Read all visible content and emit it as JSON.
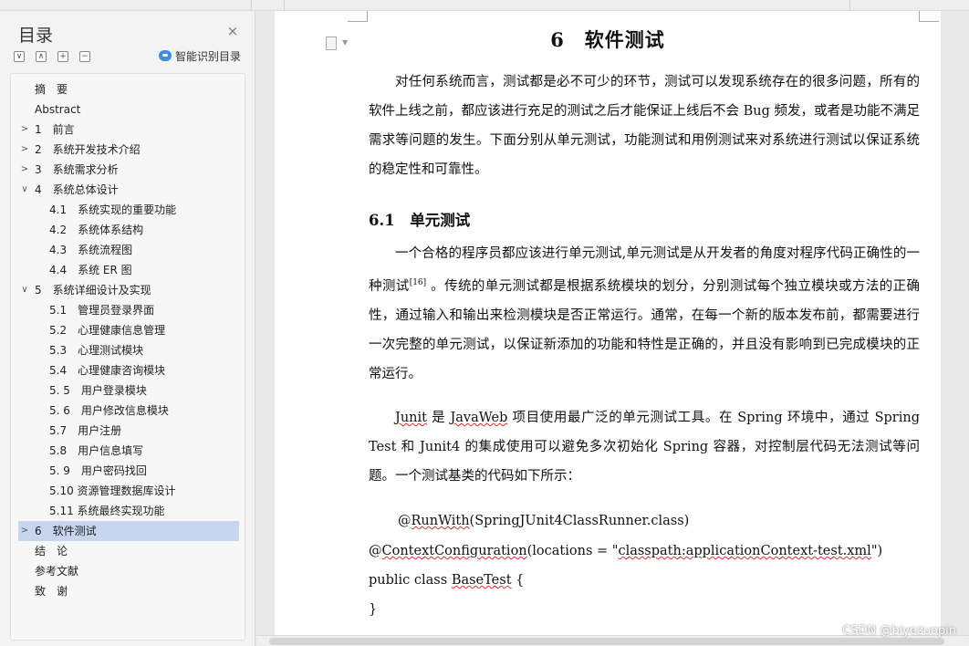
{
  "nav": {
    "title": "目录",
    "close": "×",
    "tools": [
      "∨",
      "∧",
      "+",
      "−"
    ],
    "smart_label": "智能识别目录",
    "items": [
      {
        "label": "摘　要",
        "level": 0,
        "arrow": ""
      },
      {
        "label": "Abstract",
        "level": 0,
        "arrow": ""
      },
      {
        "label": "1　前言",
        "level": 0,
        "arrow": ">"
      },
      {
        "label": "2　系统开发技术介绍",
        "level": 0,
        "arrow": ">"
      },
      {
        "label": "3　系统需求分析",
        "level": 0,
        "arrow": ">"
      },
      {
        "label": "4　系统总体设计",
        "level": 0,
        "arrow": "∨"
      },
      {
        "label": "4.1　系统实现的重要功能",
        "level": 1,
        "arrow": ""
      },
      {
        "label": "4.2　系统体系结构",
        "level": 1,
        "arrow": ""
      },
      {
        "label": "4.3　系统流程图",
        "level": 1,
        "arrow": ""
      },
      {
        "label": "4.4　系统 ER 图",
        "level": 1,
        "arrow": ""
      },
      {
        "label": "5　系统详细设计及实现",
        "level": 0,
        "arrow": "∨"
      },
      {
        "label": "5.1　管理员登录界面",
        "level": 1,
        "arrow": ""
      },
      {
        "label": "5.2　心理健康信息管理",
        "level": 1,
        "arrow": ""
      },
      {
        "label": "5.3　心理测试模块",
        "level": 1,
        "arrow": ""
      },
      {
        "label": "5.4　心理健康咨询模块",
        "level": 1,
        "arrow": ""
      },
      {
        "label": "5. 5　用户登录模块",
        "level": 1,
        "arrow": ""
      },
      {
        "label": "5. 6　用户修改信息模块",
        "level": 1,
        "arrow": ""
      },
      {
        "label": "5.7　用户注册",
        "level": 1,
        "arrow": ""
      },
      {
        "label": "5.8　用户信息填写",
        "level": 1,
        "arrow": ""
      },
      {
        "label": "5. 9　用户密码找回",
        "level": 1,
        "arrow": ""
      },
      {
        "label": "5.10 资源管理数据库设计",
        "level": 1,
        "arrow": ""
      },
      {
        "label": "5.11 系统最终实现功能",
        "level": 1,
        "arrow": ""
      },
      {
        "label": "6　软件测试",
        "level": 0,
        "arrow": ">",
        "active": true
      },
      {
        "label": "结　论",
        "level": 0,
        "arrow": ""
      },
      {
        "label": "参考文献",
        "level": 0,
        "arrow": ""
      },
      {
        "label": "致　谢",
        "level": 0,
        "arrow": ""
      }
    ]
  },
  "doc": {
    "chapter_title": "6　软件测试",
    "intro": "对任何系统而言，测试都是必不可少的环节，测试可以发现系统存在的很多问题，所有的软件上线之前，都应该进行充足的测试之后才能保证上线后不会 Bug 频发，或者是功能不满足需求等问题的发生。下面分别从单元测试，功能测试和用例测试来对系统进行测试以保证系统的稳定性和可靠性。",
    "section_title": "6.1　单元测试",
    "unit_a": "一个合格的程序员都应该进行单元测试,单元测试是从开发者的角度对程序代码正确性的一种测试",
    "unit_ref": "[16]",
    "unit_b": " 。传统的单元测试都是根据系统模块的划分，分别测试每个独立模块或方法的正确性，通过输入和输出来检测模块是否正常运行。通常，在每一个新的版本发布前，都需要进行一次完整的单元测试，以保证新添加的功能和特性是正确的，并且没有影响到已完成模块的正常运行。",
    "junit_w1": "Junit",
    "junit_t1": " 是 ",
    "junit_w2": "JavaWeb",
    "junit_t2": " 项目使用最广泛的单元测试工具。在 Spring 环境中，通过 Spring Test 和  Junit4 的集成使用可以避免多次初始化 Spring 容器，对控制层代码无法测试等问题。一个测试基类的代码如下所示：",
    "code1_a": "@",
    "code1_w": "RunWith",
    "code1_b": "(SpringJUnit4ClassRunner.class)",
    "code2_a": "@",
    "code2_w": "ContextConfiguration",
    "code2_b": "(locations = \"",
    "code2_w2": "classpath:applicationContext-test.xml",
    "code2_c": "\")",
    "code3_a": "public class ",
    "code3_w": "BaseTest",
    "code3_b": " {",
    "code4": "}"
  },
  "watermark": "CSDN @biyezuopin"
}
